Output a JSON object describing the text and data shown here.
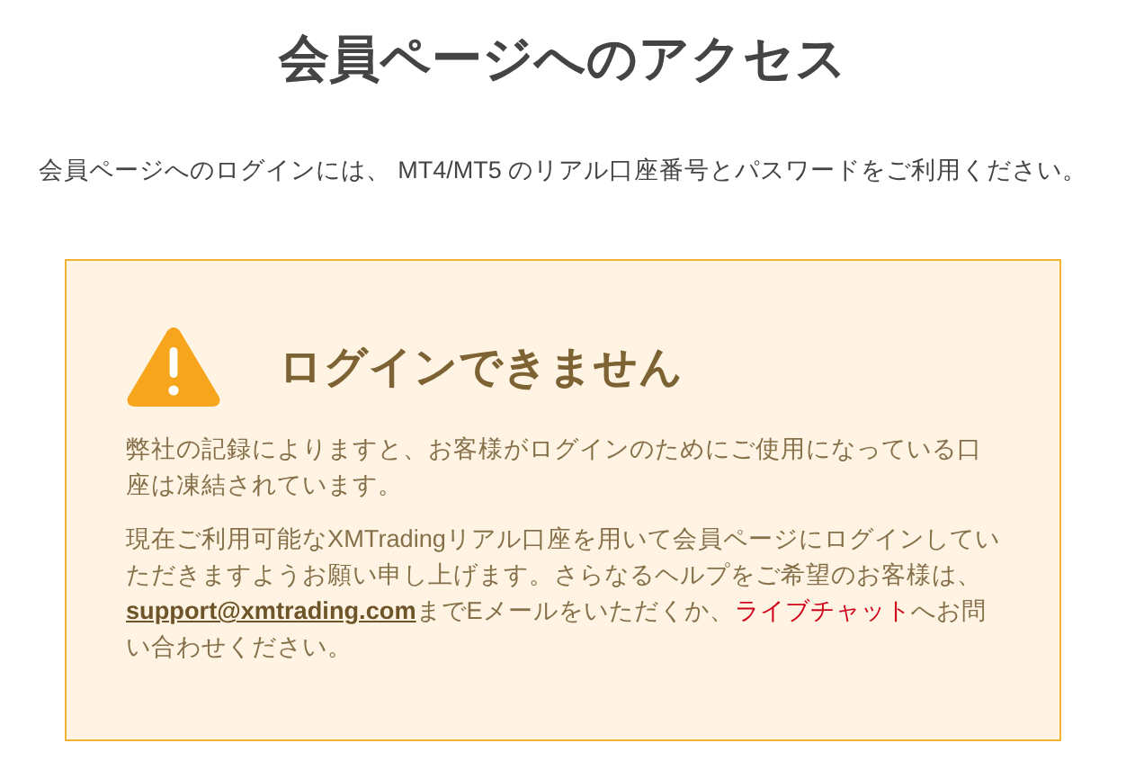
{
  "page_title": "会員ページへのアクセス",
  "intro": "会員ページへのログインには、 MT4/MT5 のリアル口座番号とパスワードをご利用ください。",
  "alert": {
    "kind": "warning",
    "title": "ログインできません",
    "message": "弊社の記録によりますと、お客様がログインのためにご使用になっている口座は凍結されています。",
    "help": {
      "before": "現在ご利用可能なXMTradingリアル口座を用いて会員ページにログインしていただきますようお願い申し上げます。さらなるヘルプをご希望のお客様は、",
      "email": "support@xmtrading.com",
      "middle": "までEメールをいただくか、",
      "chat": "ライブチャット",
      "after": "へお問い合わせください。"
    }
  }
}
